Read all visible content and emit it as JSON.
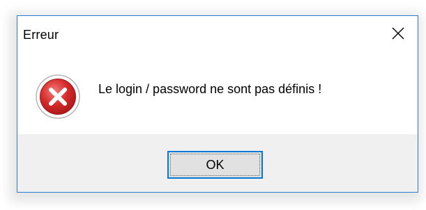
{
  "dialog": {
    "title": "Erreur",
    "message": "Le login / password ne sont pas définis !",
    "ok_label": "OK",
    "icon": "error-icon",
    "close_icon": "close-icon"
  },
  "colors": {
    "window_border": "#2b79d1",
    "error_red": "#d42a2a",
    "button_focus": "#0078d7",
    "footer_bg": "#f0f0f0"
  }
}
